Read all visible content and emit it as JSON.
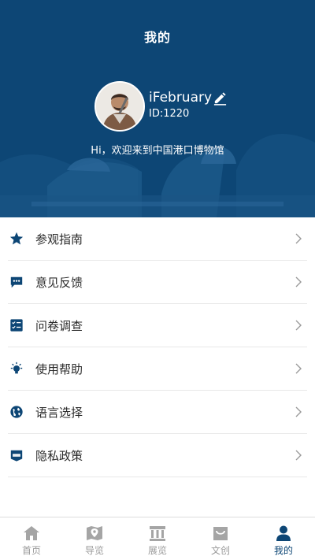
{
  "header": {
    "title": "我的",
    "username": "iFebruary",
    "user_id": "ID:1220",
    "welcome": "Hi，欢迎来到中国港口博物馆"
  },
  "menu": {
    "items": [
      {
        "label": "参观指南",
        "icon": "star-icon"
      },
      {
        "label": "意见反馈",
        "icon": "feedback-bubble-icon"
      },
      {
        "label": "问卷调查",
        "icon": "checklist-icon"
      },
      {
        "label": "使用帮助",
        "icon": "lightbulb-icon"
      },
      {
        "label": "语言选择",
        "icon": "globe-icon"
      },
      {
        "label": "隐私政策",
        "icon": "sos-shield-icon"
      }
    ]
  },
  "tabbar": {
    "items": [
      {
        "label": "首页",
        "icon": "home-icon"
      },
      {
        "label": "导览",
        "icon": "map-pin-icon"
      },
      {
        "label": "展览",
        "icon": "museum-icon"
      },
      {
        "label": "文创",
        "icon": "shopping-bag-icon"
      },
      {
        "label": "我的",
        "icon": "user-icon"
      }
    ],
    "active": "我的"
  },
  "colors": {
    "primary": "#0d4675",
    "text": "#2b2b2b",
    "inactive": "#9a9a9a",
    "divider": "#e8e8e8"
  }
}
